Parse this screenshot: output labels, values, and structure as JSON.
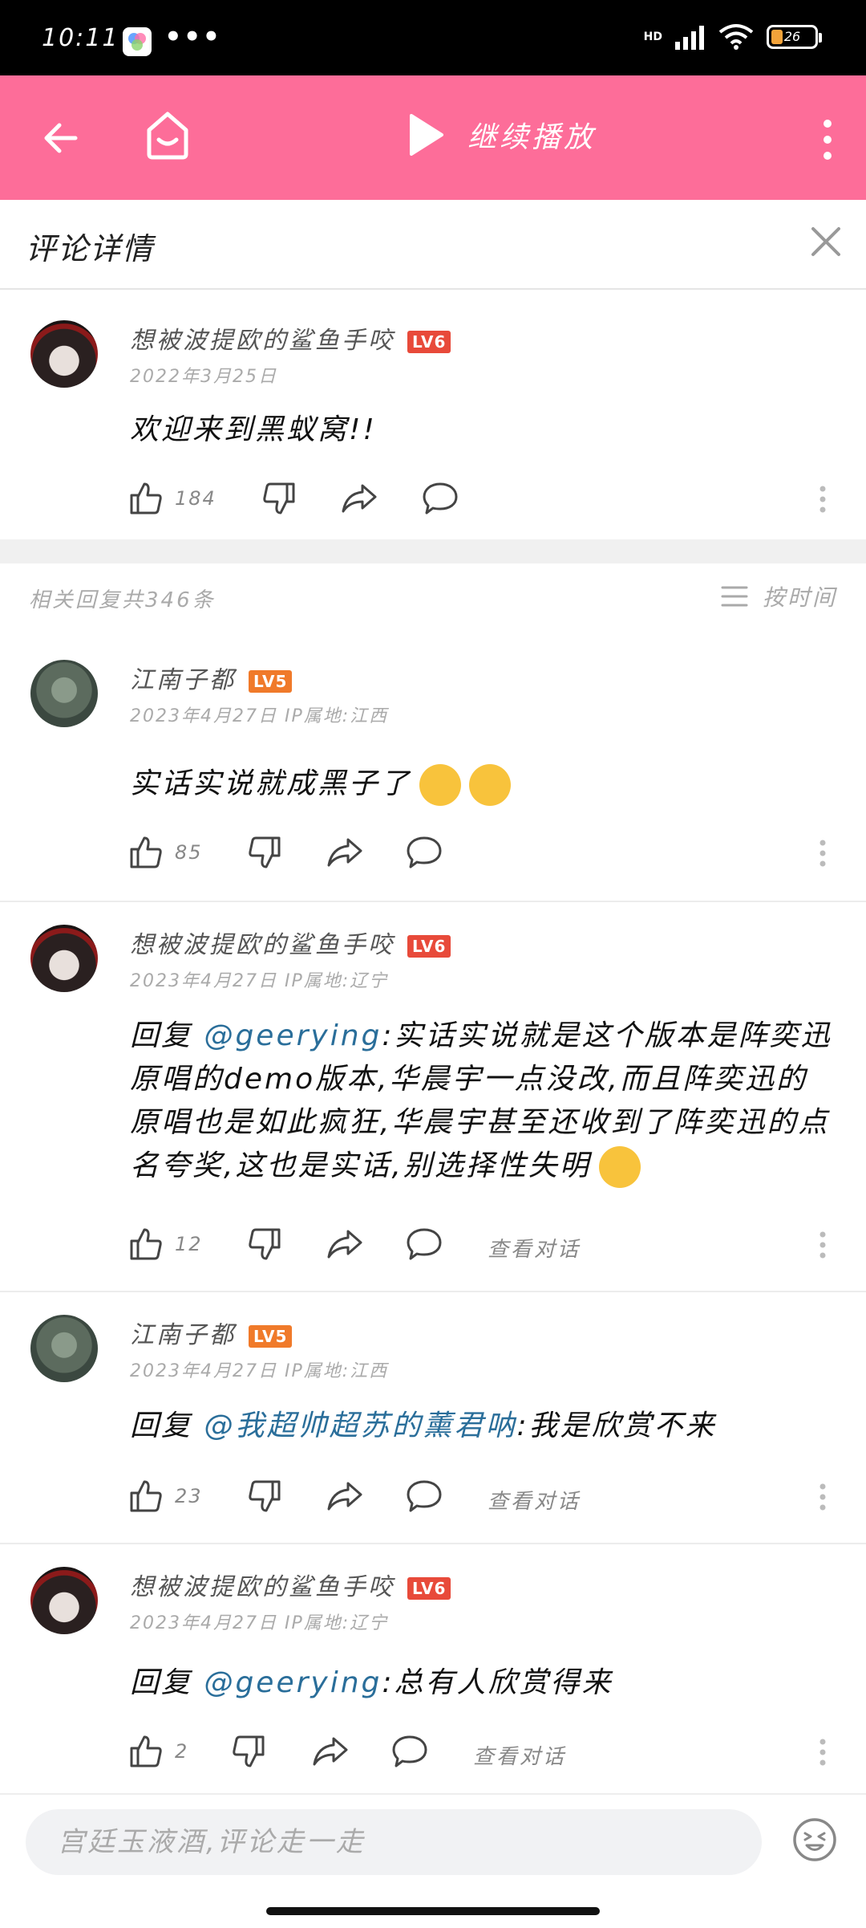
{
  "status_bar": {
    "time": "10:11",
    "overflow": "•••",
    "network": "HD",
    "battery_percent": "26",
    "battery_level": 0.26
  },
  "app_bar": {
    "play_label": "继续播放"
  },
  "detail": {
    "title": "评论详情"
  },
  "main_comment": {
    "username": "想被波提欧的鲨鱼手咬",
    "level": "LV6",
    "date": "2022年3月25日",
    "text": "欢迎来到黑蚁窝!!",
    "likes": "184"
  },
  "replies_header": {
    "count_label": "相关回复共346条",
    "sort_label": "按时间"
  },
  "replies": [
    {
      "username": "江南子都",
      "level": "LV5",
      "meta": "2023年4月27日 IP属地:江西",
      "text": "实话实说就成黑子了",
      "likes": "85"
    },
    {
      "username": "想被波提欧的鲨鱼手咬",
      "level": "LV6",
      "meta": "2023年4月27日 IP属地:辽宁",
      "prefix": "回复 ",
      "mention": "@geerying",
      "text": ":实话实说就是这个版本是阵奕迅原唱的demo版本,华晨宇一点没改,而且阵奕迅的原唱也是如此疯狂,华晨宇甚至还收到了阵奕迅的点名夸奖,这也是实话,别选择性失明",
      "likes": "12",
      "view_conversation": "查看对话"
    },
    {
      "username": "江南子都",
      "level": "LV5",
      "meta": "2023年4月27日 IP属地:江西",
      "prefix": "回复 ",
      "mention": "@我超帅超苏的薰君呐",
      "text": ":我是欣赏不来",
      "likes": "23",
      "view_conversation": "查看对话"
    },
    {
      "username": "想被波提欧的鲨鱼手咬",
      "level": "LV6",
      "meta": "2023年4月27日 IP属地:辽宁",
      "prefix": "回复 ",
      "mention": "@geerying",
      "text": ":总有人欣赏得来",
      "likes": "2",
      "view_conversation": "查看对话"
    }
  ],
  "input": {
    "placeholder": "宫廷玉液酒,评论走一走"
  },
  "colors": {
    "brand_pink": "#fd6d99",
    "mention_blue": "#2a6e9a",
    "lv6_red": "#e84a3a",
    "lv5_orange": "#f07a2a"
  }
}
